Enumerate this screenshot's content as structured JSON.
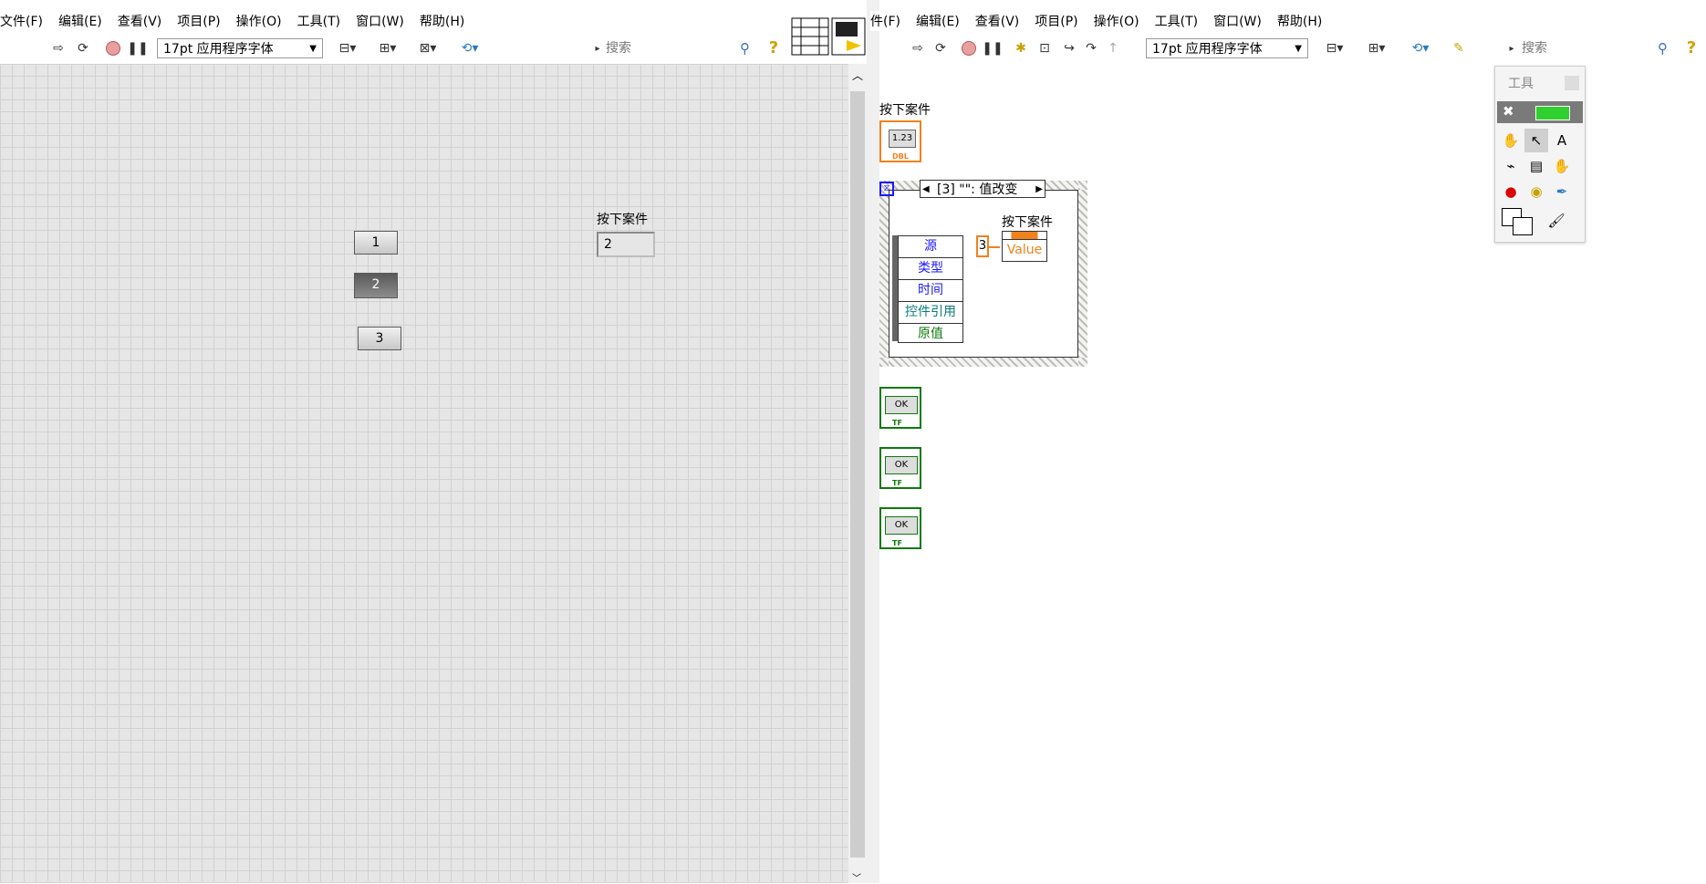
{
  "menu_left": [
    "文件(F)",
    "编辑(E)",
    "查看(V)",
    "项目(P)",
    "操作(O)",
    "工具(T)",
    "窗口(W)",
    "帮助(H)"
  ],
  "menu_right": [
    "件(F)",
    "编辑(E)",
    "查看(V)",
    "项目(P)",
    "操作(O)",
    "工具(T)",
    "窗口(W)",
    "帮助(H)"
  ],
  "toolbar": {
    "font_select": "17pt 应用程序字体",
    "search_placeholder": "搜索",
    "help": "?"
  },
  "front_panel": {
    "buttons": [
      {
        "label": "1",
        "pressed": false
      },
      {
        "label": "2",
        "pressed": true
      },
      {
        "label": "3",
        "pressed": false
      }
    ],
    "indicator_label": "按下案件",
    "indicator_value": "2"
  },
  "block_diagram": {
    "terminal_label": "按下案件",
    "terminal_type": "1.23",
    "terminal_badge": "DBL",
    "case_selector": "[3] \"\": 值改变",
    "event_fields": [
      "源",
      "类型",
      "时间",
      "控件引用",
      "原值"
    ],
    "constant": "3",
    "property_label": "按下案件",
    "property_value": "Value",
    "ok_terminals": [
      {
        "text": "OK",
        "badge": "TF"
      },
      {
        "text": "OK",
        "badge": "TF"
      },
      {
        "text": "OK",
        "badge": "TF"
      }
    ]
  },
  "tools_palette": {
    "title": "工具"
  },
  "colors": {
    "grid_bg": "#e6e6e6",
    "bool_green": "#0e7a0e",
    "dbl_orange": "#f0821e",
    "event_blue": "#1a1aff"
  }
}
